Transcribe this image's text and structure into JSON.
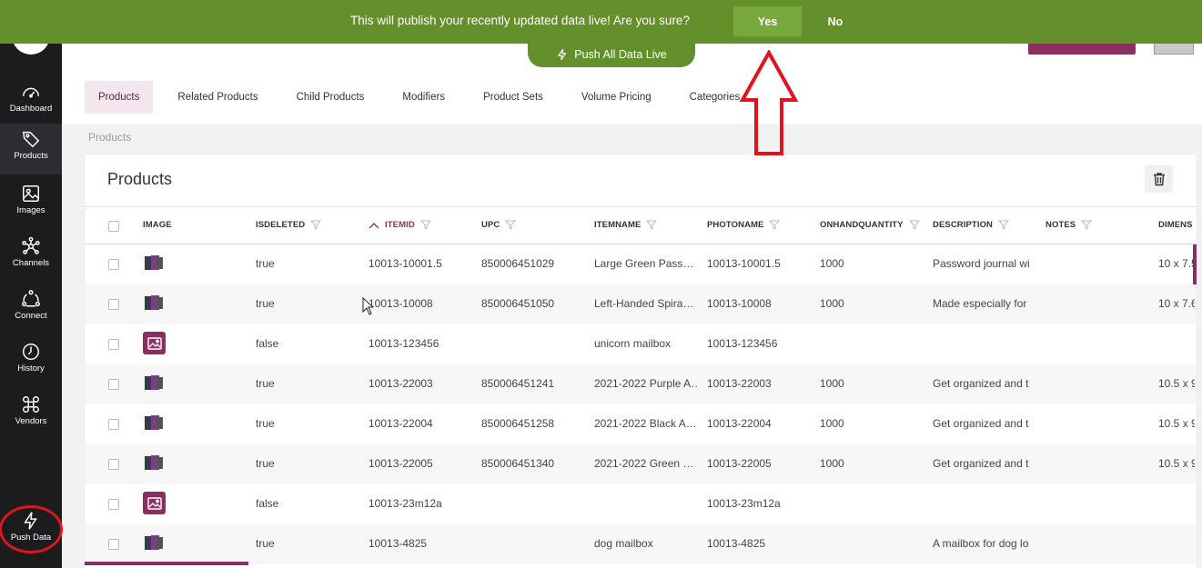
{
  "confirm": {
    "message": "This will publish your recently updated data live! Are you sure?",
    "yes_label": "Yes",
    "no_label": "No",
    "push_all_label": "Push All Data Live"
  },
  "sidebar": {
    "items": [
      {
        "label": "Dashboard",
        "icon": "dashboard-icon"
      },
      {
        "label": "Products",
        "icon": "tag-icon"
      },
      {
        "label": "Images",
        "icon": "image-icon"
      },
      {
        "label": "Channels",
        "icon": "network-icon"
      },
      {
        "label": "Connect",
        "icon": "connect-icon"
      },
      {
        "label": "History",
        "icon": "clock-icon"
      },
      {
        "label": "Vendors",
        "icon": "vendors-icon"
      },
      {
        "label": "Push Data",
        "icon": "lightning-icon"
      }
    ]
  },
  "tabs": [
    "Products",
    "Related Products",
    "Child Products",
    "Modifiers",
    "Product Sets",
    "Volume Pricing",
    "Categories"
  ],
  "breadcrumb": "Products",
  "panel": {
    "title": "Products"
  },
  "table": {
    "columns": [
      "IMAGE",
      "ISDELETED",
      "ITEMID",
      "UPC",
      "ITEMNAME",
      "PHOTONAME",
      "ONHANDQUANTITY",
      "DESCRIPTION",
      "NOTES",
      "DIMENS"
    ],
    "rows": [
      {
        "image": "photo",
        "isdeleted": "true",
        "itemid": "10013-10001.5",
        "upc": "850006451029",
        "itemname": "Large Green Pass…",
        "photoname": "10013-10001.5",
        "qty": "1000",
        "description": "Password journal wi",
        "notes": "",
        "dimens": "10 x 7.5"
      },
      {
        "image": "photo",
        "isdeleted": "true",
        "itemid": "10013-10008",
        "upc": "850006451050",
        "itemname": "Left-Handed Spira…",
        "photoname": "10013-10008",
        "qty": "1000",
        "description": "Made especially for",
        "notes": "",
        "dimens": "10 x 7.6"
      },
      {
        "image": "placeholder",
        "isdeleted": "false",
        "itemid": "10013-123456",
        "upc": "",
        "itemname": "unicorn mailbox",
        "photoname": "10013-123456",
        "qty": "",
        "description": "",
        "notes": "",
        "dimens": ""
      },
      {
        "image": "photo",
        "isdeleted": "true",
        "itemid": "10013-22003",
        "upc": "850006451241",
        "itemname": "2021-2022 Purple A…",
        "photoname": "10013-22003",
        "qty": "1000",
        "description": "Get organized and t",
        "notes": "",
        "dimens": "10.5 x 9"
      },
      {
        "image": "photo",
        "isdeleted": "true",
        "itemid": "10013-22004",
        "upc": "850006451258",
        "itemname": "2021-2022 Black A…",
        "photoname": "10013-22004",
        "qty": "1000",
        "description": "Get organized and t",
        "notes": "",
        "dimens": "10.5 x 9"
      },
      {
        "image": "photo",
        "isdeleted": "true",
        "itemid": "10013-22005",
        "upc": "850006451340",
        "itemname": "2021-2022 Green …",
        "photoname": "10013-22005",
        "qty": "1000",
        "description": "Get organized and t",
        "notes": "",
        "dimens": "10.5 x 9"
      },
      {
        "image": "placeholder",
        "isdeleted": "false",
        "itemid": "10013-23m12a",
        "upc": "",
        "itemname": "",
        "photoname": "10013-23m12a",
        "qty": "",
        "description": "",
        "notes": "",
        "dimens": ""
      },
      {
        "image": "photo",
        "isdeleted": "true",
        "itemid": "10013-4825",
        "upc": "",
        "itemname": "dog mailbox",
        "photoname": "10013-4825",
        "qty": "",
        "description": "A mailbox for dog lo",
        "notes": "",
        "dimens": ""
      }
    ]
  },
  "colors": {
    "accent": "#8d2e63",
    "confirm_bar": "#63902a",
    "sidebar": "#1b1c1e",
    "annotation": "#e0141e"
  }
}
